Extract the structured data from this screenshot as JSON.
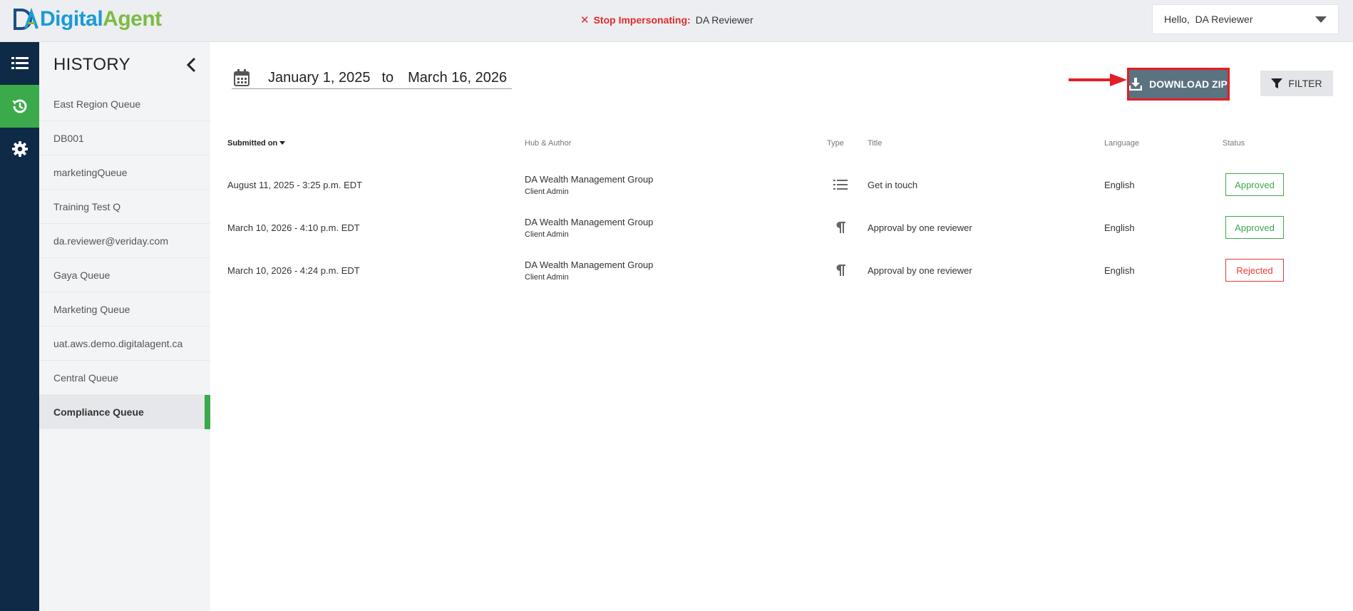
{
  "header": {
    "logo_digital": "Digital",
    "logo_agent": "Agent",
    "impersonate_stop": "Stop Impersonating:",
    "impersonate_name": "DA Reviewer",
    "user_greeting": "Hello,  DA Reviewer"
  },
  "rail": {
    "items": [
      {
        "icon": "list-icon",
        "active": false
      },
      {
        "icon": "history-icon",
        "active": true
      },
      {
        "icon": "gear-icon",
        "active": false
      }
    ]
  },
  "sidebar": {
    "title": "HISTORY",
    "items": [
      {
        "label": "East Region Queue"
      },
      {
        "label": "DB001"
      },
      {
        "label": "marketingQueue"
      },
      {
        "label": "Training Test Q"
      },
      {
        "label": "da.reviewer@veriday.com"
      },
      {
        "label": "Gaya Queue"
      },
      {
        "label": "Marketing Queue"
      },
      {
        "label": "uat.aws.demo.digitalagent.ca"
      },
      {
        "label": "Central Queue"
      },
      {
        "label": "Compliance Queue"
      }
    ],
    "active_index": 9
  },
  "date_range": {
    "start": "January 1, 2025",
    "separator": "to",
    "end": "March 16, 2026"
  },
  "toolbar": {
    "download_label": "DOWNLOAD ZIP",
    "filter_label": "FILTER"
  },
  "table": {
    "headers": {
      "submitted": "Submitted on",
      "hub": "Hub & Author",
      "type": "Type",
      "title": "Title",
      "language": "Language",
      "status": "Status"
    },
    "rows": [
      {
        "submitted": "August 11, 2025 - 3:25 p.m. EDT",
        "hub": "DA Wealth Management Group",
        "author": "Client Admin",
        "type_icon": "list-icon",
        "title": "Get in touch",
        "language": "English",
        "status": "Approved"
      },
      {
        "submitted": "March 10, 2026 - 4:10 p.m. EDT",
        "hub": "DA Wealth Management Group",
        "author": "Client Admin",
        "type_icon": "paragraph-icon",
        "title": "Approval by one reviewer",
        "language": "English",
        "status": "Approved"
      },
      {
        "submitted": "March 10, 2026 - 4:24 p.m. EDT",
        "hub": "DA Wealth Management Group",
        "author": "Client Admin",
        "type_icon": "paragraph-icon",
        "title": "Approval by one reviewer",
        "language": "English",
        "status": "Rejected"
      }
    ]
  },
  "colors": {
    "nav_dark": "#0f2a47",
    "accent_green": "#3aaa4a",
    "danger_red": "#e02b2b",
    "download_button": "#5b7281"
  }
}
